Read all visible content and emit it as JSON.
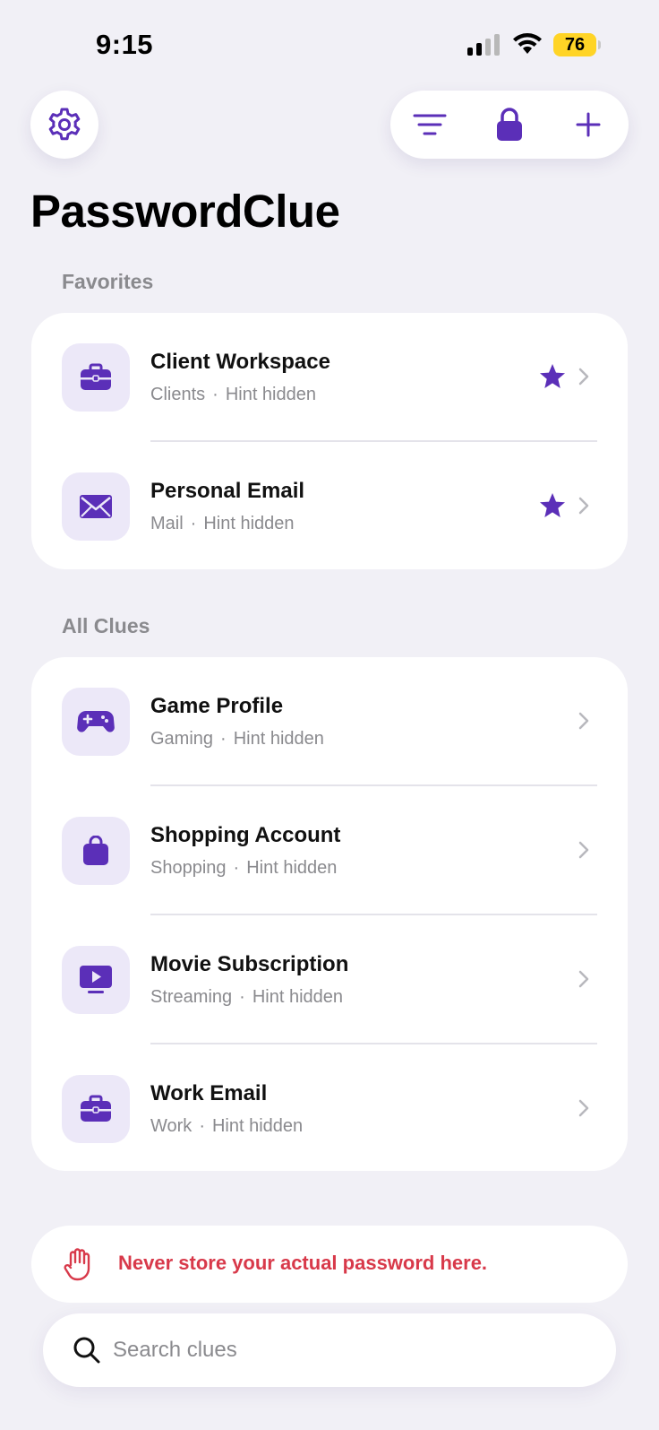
{
  "status_bar": {
    "time": "9:15",
    "battery": "76"
  },
  "app": {
    "title": "PasswordClue",
    "accent": "#5b2fb8",
    "danger": "#d8394a"
  },
  "toolbar": {
    "icons": [
      "filter-icon",
      "lock-icon",
      "plus-icon"
    ]
  },
  "favorites": {
    "label": "Favorites",
    "items": [
      {
        "title": "Client Workspace",
        "category": "Clients",
        "sep": "·",
        "hint": "Hint hidden",
        "icon": "briefcase-icon",
        "favorite": true
      },
      {
        "title": "Personal Email",
        "category": "Mail",
        "sep": "·",
        "hint": "Hint hidden",
        "icon": "envelope-icon",
        "favorite": true
      }
    ]
  },
  "all_clues": {
    "label": "All Clues",
    "items": [
      {
        "title": "Game Profile",
        "category": "Gaming",
        "sep": "·",
        "hint": "Hint hidden",
        "icon": "gamepad-icon",
        "favorite": false
      },
      {
        "title": "Shopping Account",
        "category": "Shopping",
        "sep": "·",
        "hint": "Hint hidden",
        "icon": "shopping-bag-icon",
        "favorite": false
      },
      {
        "title": "Movie Subscription",
        "category": "Streaming",
        "sep": "·",
        "hint": "Hint hidden",
        "icon": "tv-play-icon",
        "favorite": false
      },
      {
        "title": "Work Email",
        "category": "Work",
        "sep": "·",
        "hint": "Hint hidden",
        "icon": "briefcase-icon",
        "favorite": false
      }
    ]
  },
  "warning": {
    "text": "Never store your actual password here.",
    "icon": "hand-stop-icon"
  },
  "search": {
    "placeholder": "Search clues",
    "value": ""
  }
}
